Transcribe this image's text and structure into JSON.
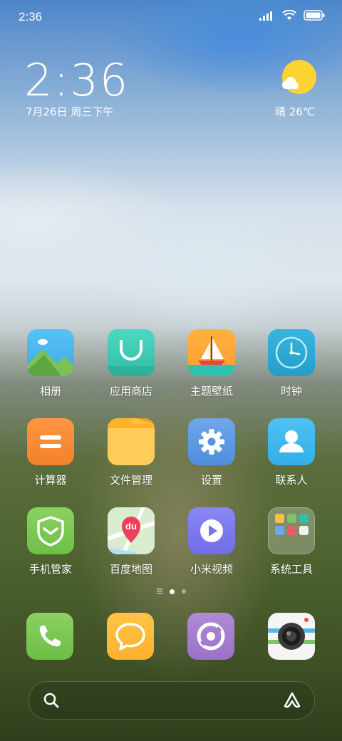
{
  "status_bar": {
    "time": "2:36",
    "icons": [
      "signal-icon",
      "wifi-icon",
      "battery-icon"
    ]
  },
  "clock_widget": {
    "time": "2:36",
    "date": "7月26日 周三下午"
  },
  "weather_widget": {
    "text": "晴 26℃",
    "icon": "sunny-icon"
  },
  "apps": [
    {
      "label": "相册",
      "icon": "gallery-icon"
    },
    {
      "label": "应用商店",
      "icon": "app-store-icon"
    },
    {
      "label": "主题壁纸",
      "icon": "themes-icon"
    },
    {
      "label": "时钟",
      "icon": "clock-icon"
    },
    {
      "label": "计算器",
      "icon": "calculator-icon"
    },
    {
      "label": "文件管理",
      "icon": "folder-icon"
    },
    {
      "label": "设置",
      "icon": "settings-gear-icon"
    },
    {
      "label": "联系人",
      "icon": "contacts-icon"
    },
    {
      "label": "手机管家",
      "icon": "security-shield-icon"
    },
    {
      "label": "百度地图",
      "icon": "baidu-map-icon",
      "badge_text": "du"
    },
    {
      "label": "小米视频",
      "icon": "video-play-icon"
    },
    {
      "label": "系统工具",
      "icon": "tools-folder-icon"
    }
  ],
  "page_indicator": {
    "pages": 2,
    "current": 1
  },
  "dock": [
    {
      "icon": "phone-icon"
    },
    {
      "icon": "messages-icon"
    },
    {
      "icon": "browser-icon"
    },
    {
      "icon": "camera-icon"
    }
  ],
  "search_bar": {
    "left_icon": "search-icon",
    "right_icon": "assistant-icon"
  }
}
